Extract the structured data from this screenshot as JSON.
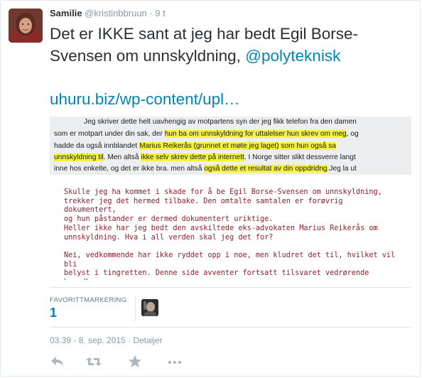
{
  "tweet": {
    "author_name": "Samilie",
    "handle": "@kristinbbruun",
    "separator": "·",
    "time": "9 t",
    "text": "Det er IKKE sant at jeg har bedt Egil Borse-Svensen om unnskyldning, ",
    "mention": "@polyteknisk",
    "link": "uhuru.biz/wp-content/upl…"
  },
  "image": {
    "scan": {
      "l1": "Jeg skriver dette helt uavhengig av motpartens syn der jeg fikk telefon fra den damen",
      "l2a": "som er motpart under din sak, der ",
      "l2b": "hun ba om unnskyldning for uttalelser hun skrev om meg",
      "l2c": ", og",
      "l3a": "hadde da også innblandet ",
      "l3b": "Marius Reikerås (grunnet et møte jeg laget) som hun også sa",
      "l4a": "unnskyldning til",
      "l4b": ". Men altså ",
      "l4c": "ikke selv skrev dette på internett",
      "l4d": ". I Norge sitter slikt dessverre langt",
      "l5a": "inne hos enkelte, og det er ikke bra. men altså ",
      "l5b": "også dette et resultat av din oppdridng",
      "l5c": ".Jeg la ut"
    },
    "p1": "Skulle jeg ha kommet i skade for å be Egil Borse-Svensen om unnskyldning,\ntrekker jeg det hermed tilbake. Den omtalte samtalen er forøvrig dokumentert,\nog hun påstander er dermed dokumentert uriktige.",
    "p2": "Heller ikke har jeg bedt den avskiltede eks-advokaten Marius Reikerås om\nunnskyldning. Hva i all verden skal jeg det for?",
    "p3": "Nei, vedkommende har ikke ryddet opp i noe, men kludret det til, hvilket vil bli\nbelyst i tingretten. Denne side avventer fortsatt tilsvaret vedrørende hovedkrav."
  },
  "stats": {
    "label": "FAVORITTMARKERING",
    "value": "1"
  },
  "timestamp": "03.39 - 8. sep. 2015 · Detaljer",
  "actions": {
    "reply_icon": "reply-icon",
    "retweet_icon": "retweet-icon",
    "favorite_icon": "star-icon",
    "more_icon": "more-icon"
  },
  "colors": {
    "link": "#0084b4",
    "muted": "#8899a6",
    "highlight": "#f5f23a",
    "quote_red": "#8f1f2a"
  }
}
